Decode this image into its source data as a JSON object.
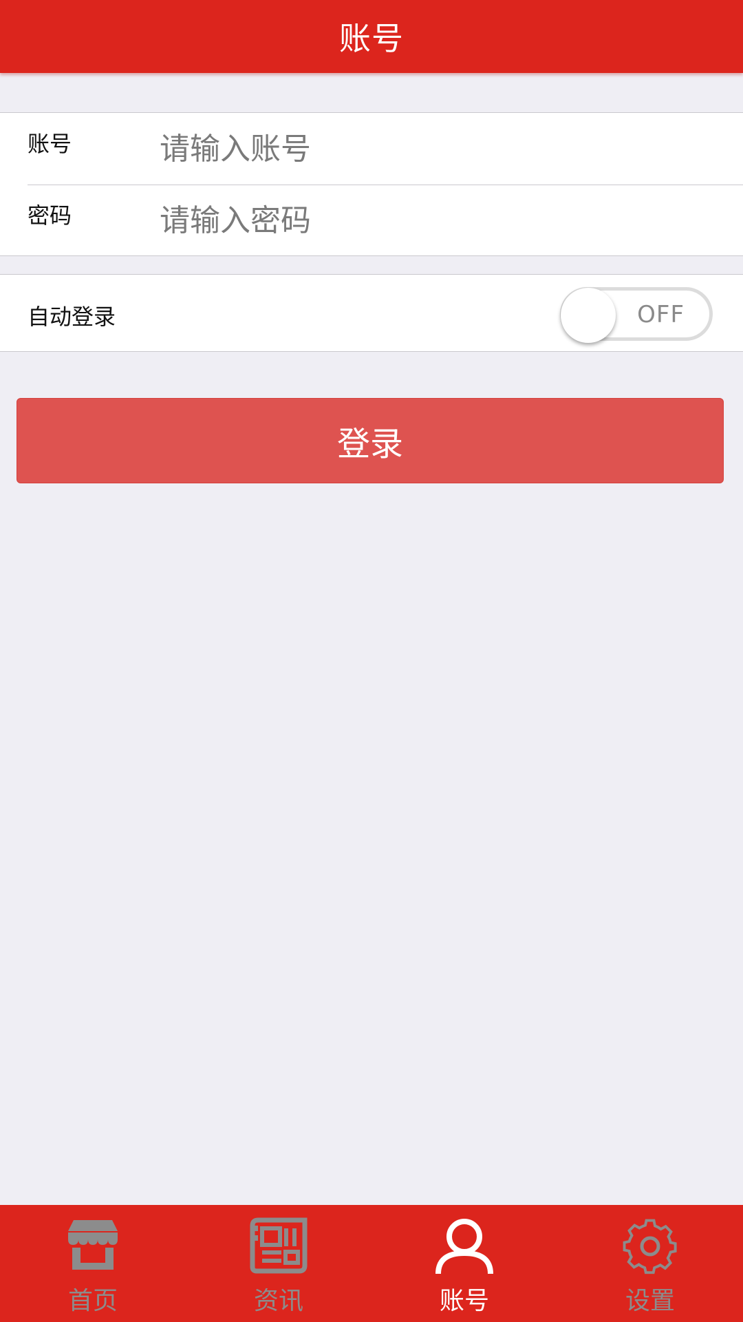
{
  "header": {
    "title": "账号"
  },
  "form": {
    "account_label": "账号",
    "account_placeholder": "请输入账号",
    "password_label": "密码",
    "password_placeholder": "请输入密码"
  },
  "auto_login": {
    "label": "自动登录",
    "state": "OFF"
  },
  "login_button": {
    "label": "登录"
  },
  "tabbar": {
    "tabs": [
      {
        "label": "首页",
        "icon": "store-icon",
        "active": false
      },
      {
        "label": "资讯",
        "icon": "newspaper-icon",
        "active": false
      },
      {
        "label": "账号",
        "icon": "user-icon",
        "active": true
      },
      {
        "label": "设置",
        "icon": "gear-icon",
        "active": false
      }
    ]
  },
  "colors": {
    "brand_red": "#dc251d",
    "button_red": "#de5350",
    "background": "#efeef4",
    "inactive_tab": "#8c8c8c"
  }
}
